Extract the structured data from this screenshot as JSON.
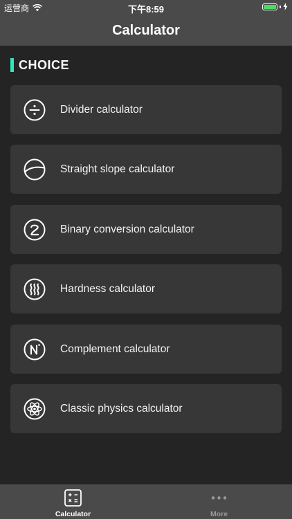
{
  "status_bar": {
    "carrier": "运营商",
    "time": "下午8:59",
    "wifi_icon": "wifi-icon",
    "battery_icon": "battery-icon",
    "charging_icon": "charging-bolt-icon"
  },
  "nav": {
    "title": "Calculator"
  },
  "section": {
    "title": "CHOICE",
    "accent_color": "#2ee8b8"
  },
  "items": [
    {
      "label": "Divider calculator",
      "icon": "divide-icon"
    },
    {
      "label": "Straight slope calculator",
      "icon": "slope-icon"
    },
    {
      "label": "Binary conversion calculator",
      "icon": "binary-2-icon"
    },
    {
      "label": "Hardness calculator",
      "icon": "hardness-waves-icon"
    },
    {
      "label": "Complement calculator",
      "icon": "complement-n-icon"
    },
    {
      "label": "Classic physics calculator",
      "icon": "atom-icon"
    }
  ],
  "tabbar": {
    "tabs": [
      {
        "label": "Calculator",
        "icon": "calculator-icon",
        "selected": true
      },
      {
        "label": "More",
        "icon": "more-dots-icon",
        "selected": false
      }
    ]
  },
  "colors": {
    "background": "#242424",
    "bar": "#4a4a4a",
    "card": "#373737",
    "inactive_tab": "#9a9a9a"
  }
}
